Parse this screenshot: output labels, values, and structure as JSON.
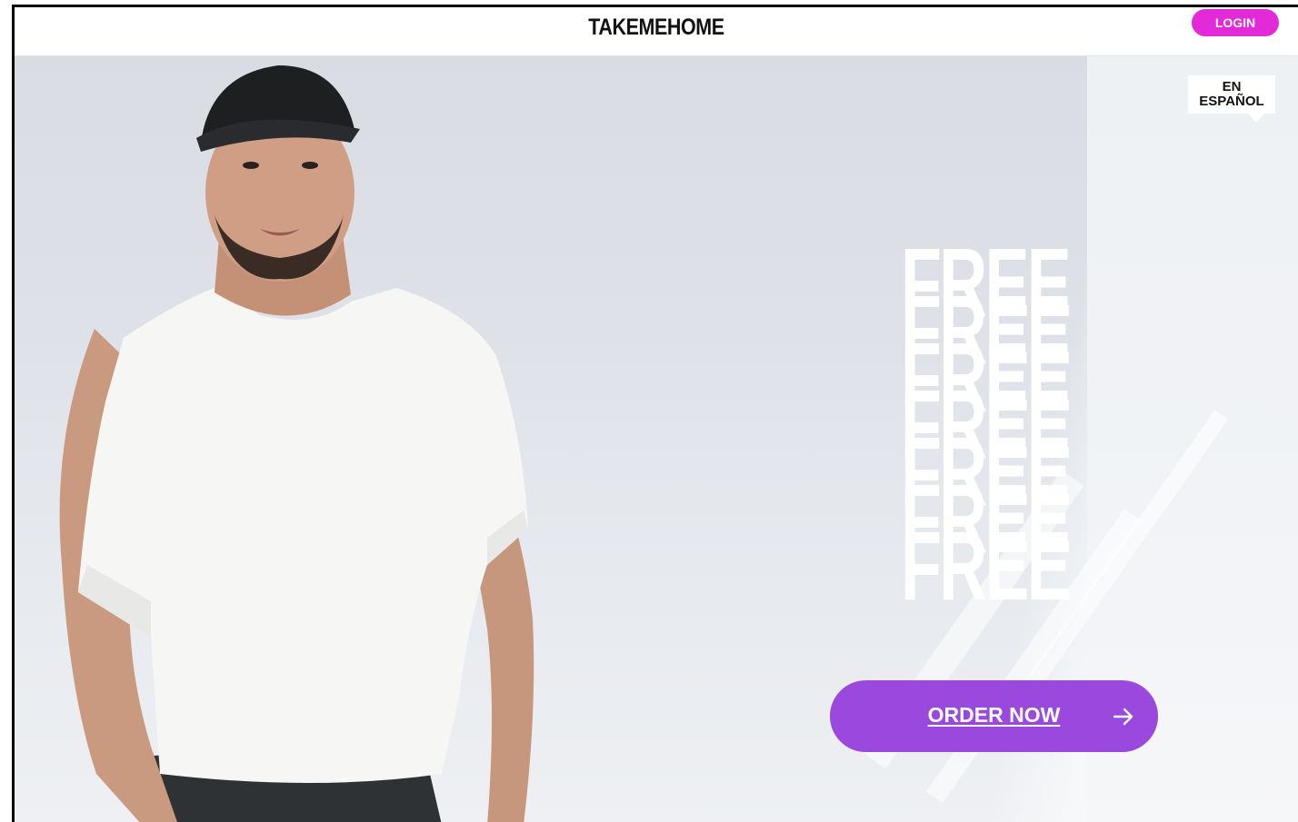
{
  "header": {
    "brand": "TAKEMEHOME",
    "login_label": "LOGIN"
  },
  "language_toggle": {
    "line1": "EN",
    "line2": "ESPAÑOL"
  },
  "hero": {
    "headline_repeated": [
      "FREE",
      "FREE",
      "FREE",
      "FREE",
      "FREE",
      "FREE",
      "FREE"
    ],
    "cta_label": "ORDER NOW",
    "cta_icon": "arrow-right-icon"
  },
  "colors": {
    "login_bg": "#e22ad8",
    "cta_bg": "#9a48de",
    "text": "#111111"
  }
}
